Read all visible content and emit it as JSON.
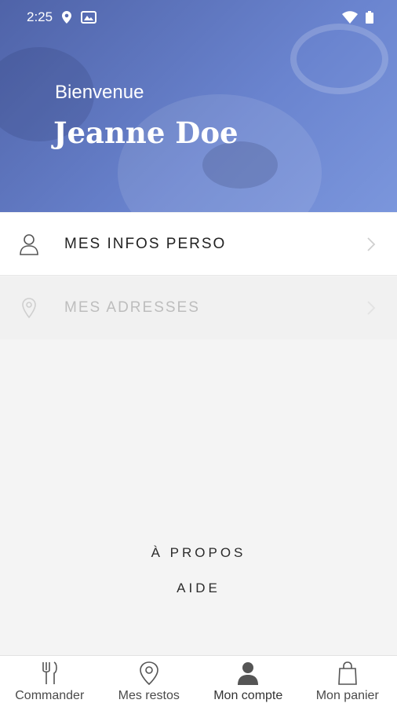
{
  "status_bar": {
    "time": "2:25"
  },
  "header": {
    "welcome": "Bienvenue",
    "user_name": "Jeanne Doe"
  },
  "menu": [
    {
      "label": "MES INFOS PERSO",
      "icon": "person-icon",
      "enabled": true
    },
    {
      "label": "MES ADRESSES",
      "icon": "location-pin-icon",
      "enabled": false
    }
  ],
  "links": {
    "about": "À PROPOS",
    "help": "AIDE"
  },
  "bottom_nav": [
    {
      "label": "Commander",
      "icon": "fork-knife-icon",
      "active": false
    },
    {
      "label": "Mes restos",
      "icon": "map-pin-icon",
      "active": false
    },
    {
      "label": "Mon compte",
      "icon": "account-icon",
      "active": true
    },
    {
      "label": "Mon panier",
      "icon": "shopping-bag-icon",
      "active": false
    }
  ],
  "colors": {
    "header_blue": "#5b73c0",
    "text_dark": "#222222",
    "disabled_text": "#bdbdbd"
  }
}
